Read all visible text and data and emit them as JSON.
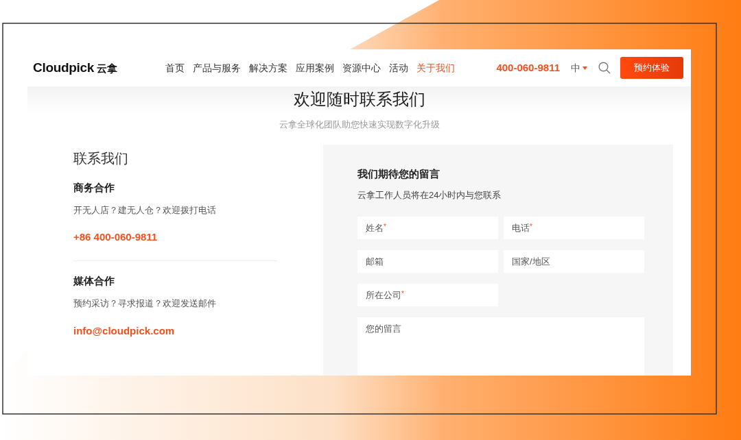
{
  "logo": {
    "text": "Cloudpick",
    "suffix": "云拿"
  },
  "nav": [
    {
      "label": "首页",
      "selected": false
    },
    {
      "label": "产品与服务",
      "selected": false
    },
    {
      "label": "解决方案",
      "selected": false
    },
    {
      "label": "应用案例",
      "selected": false
    },
    {
      "label": "资源中心",
      "selected": false
    },
    {
      "label": "活动",
      "selected": false
    },
    {
      "label": "关于我们",
      "selected": true
    }
  ],
  "phone": "400-060-9811",
  "language": "中",
  "cta_button": "预约体验",
  "hero": {
    "title": "欢迎随时联系我们",
    "subtitle": "云拿全球化团队助您快速实现数字化升级"
  },
  "contact": {
    "title": "联系我们",
    "sections": [
      {
        "heading": "商务合作",
        "text": "开无人店？建无人仓？欢迎拨打电话",
        "link": "+86 400-060-9811"
      },
      {
        "heading": "媒体合作",
        "text": "预约采访？寻求报道？欢迎发送邮件",
        "link": "info@cloudpick.com"
      }
    ]
  },
  "form": {
    "title": "我们期待您的留言",
    "subtitle": "云拿工作人员将在24小时内与您联系",
    "fields": [
      {
        "kind": "input",
        "placeholder": "姓名",
        "mark": "*"
      },
      {
        "kind": "input",
        "placeholder": "电话",
        "mark": "*"
      },
      {
        "kind": "input",
        "placeholder": "邮箱"
      },
      {
        "kind": "input",
        "placeholder": "国家/地区"
      },
      {
        "kind": "input",
        "placeholder": "所在公司",
        "mark": "*"
      },
      {
        "kind": "textarea",
        "placeholder": "您的留言"
      }
    ]
  }
}
